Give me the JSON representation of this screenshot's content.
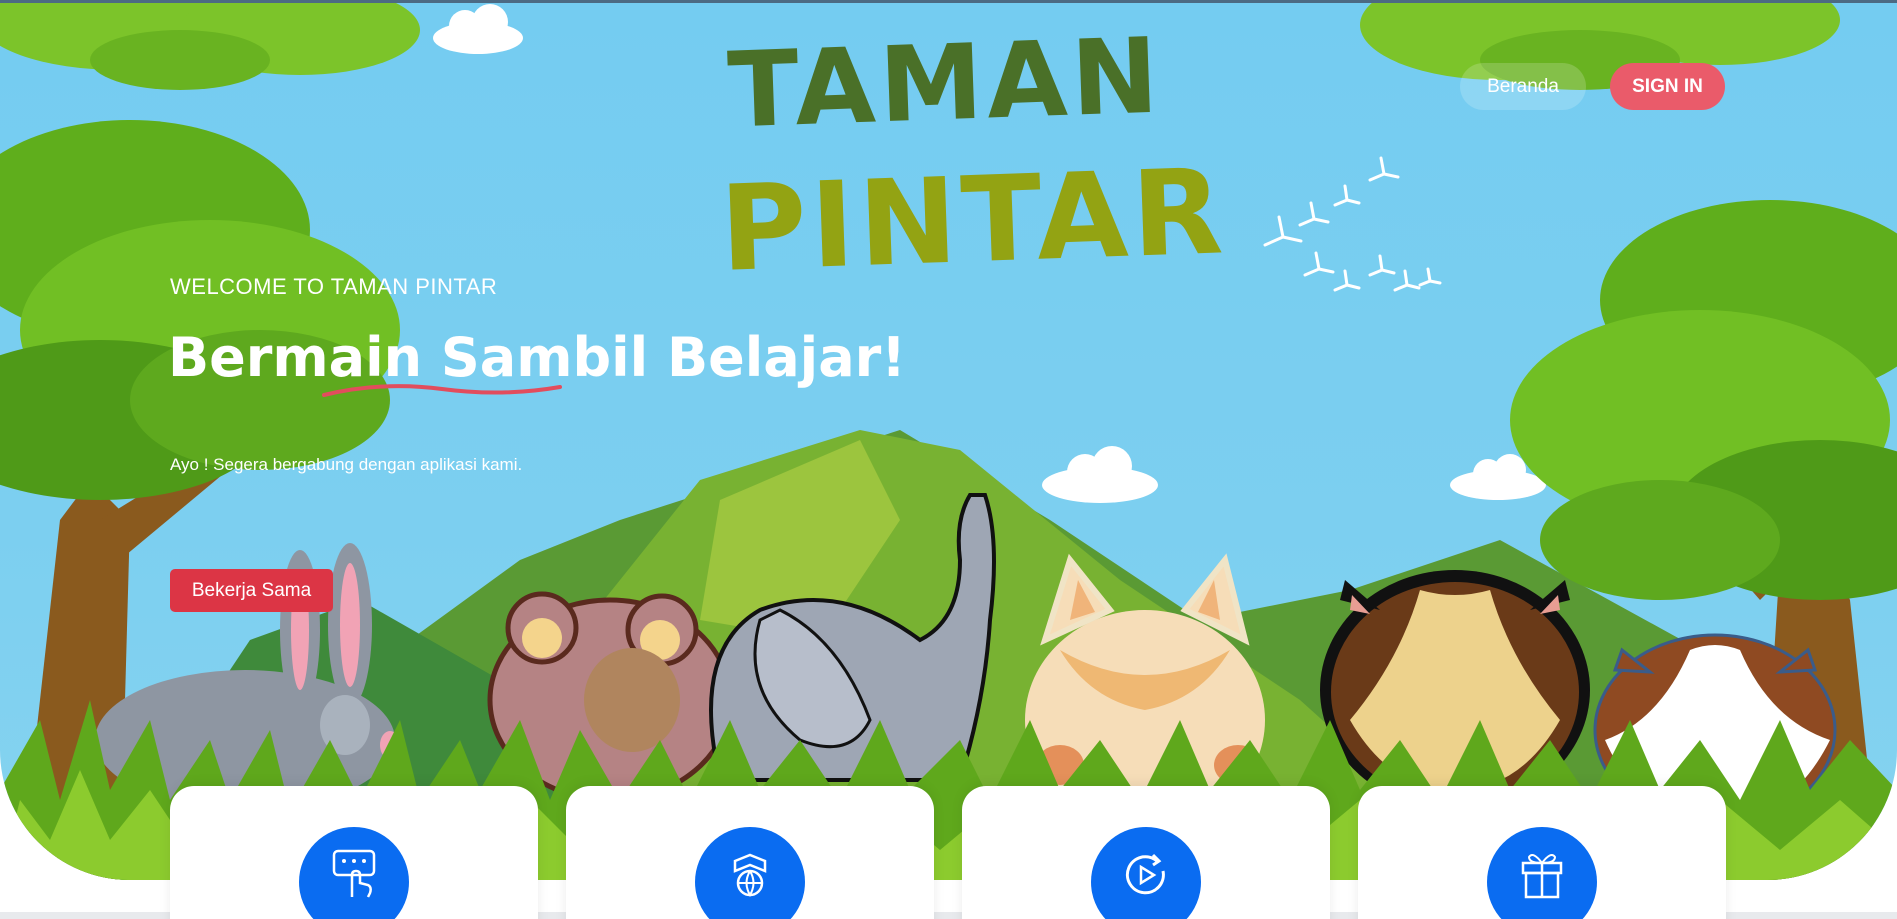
{
  "brand": {
    "line1": "TAMAN",
    "line2": "PINTAR"
  },
  "nav": {
    "home_label": "Beranda",
    "signin_label": "SIGN IN"
  },
  "hero": {
    "welcome": "WELCOME TO TAMAN PINTAR",
    "headline": "Bermain Sambil Belajar!",
    "subtext": "Ayo ! Segera bergabung dengan aplikasi kami.",
    "cta_label": "Bekerja Sama"
  },
  "features": [
    {
      "icon": "touch-screen-icon"
    },
    {
      "icon": "globe-book-icon"
    },
    {
      "icon": "replay-video-icon"
    },
    {
      "icon": "gift-icon"
    }
  ],
  "colors": {
    "sky": "#74ccf1",
    "accent_red": "#dc3545",
    "signin_pink": "#ea5b6a",
    "icon_blue": "#0a6cf1",
    "logo_dark_green": "#4a7028",
    "logo_olive": "#93a313"
  }
}
